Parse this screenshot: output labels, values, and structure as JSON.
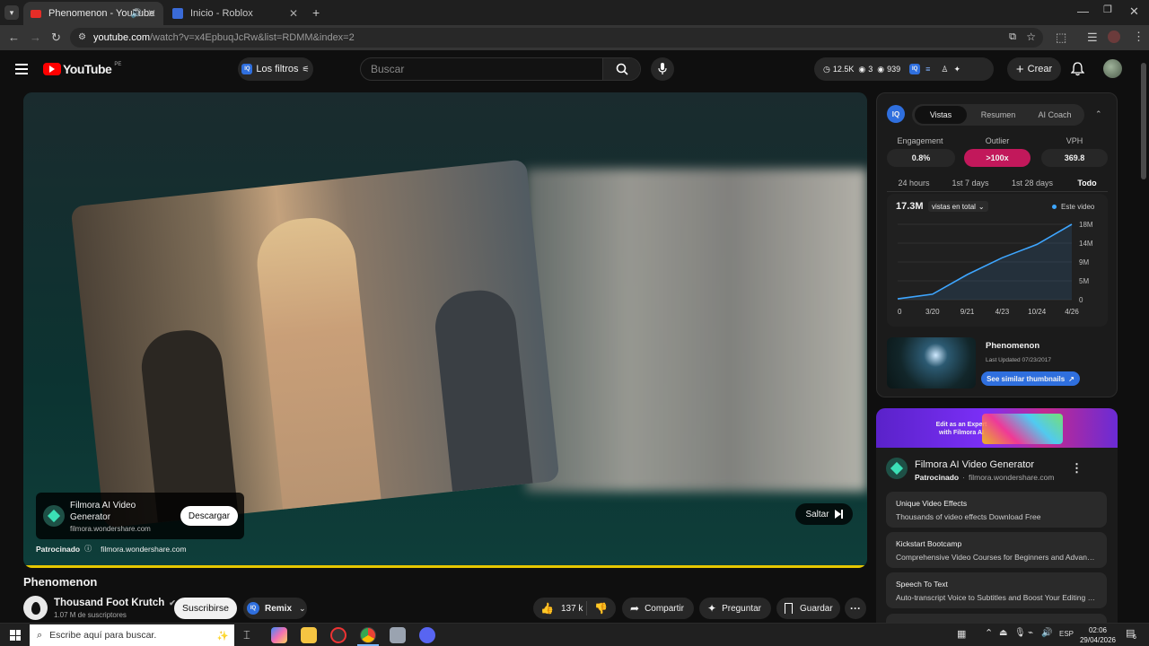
{
  "browser": {
    "tabs": [
      {
        "title": "Phenomenon - YouTube",
        "active": true
      },
      {
        "title": "Inicio - Roblox",
        "active": false
      }
    ],
    "url_host": "youtube.com",
    "url_path": "/watch?v=x4EpbuqJcRw&list=RDMM&index=2"
  },
  "masthead": {
    "logo_text": "YouTube",
    "country_code": "PE",
    "filters_label": "Los filtros",
    "search_placeholder": "Buscar",
    "stats": {
      "views": "12.5K",
      "count_a": "3",
      "count_b": "939"
    },
    "create_label": "Crear"
  },
  "ad_overlay": {
    "title_line1": "Filmora AI Video",
    "title_line2": "Generator",
    "domain": "filmora.wondershare.com",
    "download_label": "Descargar",
    "sponsored_label": "Patrocinado",
    "footer_domain": "filmora.wondershare.com",
    "skip_label": "Saltar"
  },
  "video": {
    "title": "Phenomenon",
    "channel": "Thousand Foot Krutch",
    "subscribers": "1.07 M de suscriptores",
    "subscribe_label": "Suscribirse",
    "remix_label": "Remix",
    "likes": "137 k",
    "share_label": "Compartir",
    "ask_label": "Preguntar",
    "save_label": "Guardar"
  },
  "analytics": {
    "tabs": [
      "Vistas",
      "Resumen",
      "AI Coach"
    ],
    "active_tab": "Vistas",
    "metrics": [
      {
        "label": "Engagement",
        "value": "0.8%"
      },
      {
        "label": "Outlier",
        "value": ">100x"
      },
      {
        "label": "VPH",
        "value": "369.8"
      }
    ],
    "ranges": [
      "24 hours",
      "1st 7 days",
      "1st 28 days",
      "Todo"
    ],
    "active_range": "Todo",
    "total_views": "17.3M",
    "views_dropdown": "vistas en total",
    "legend_label": "Este video",
    "related_title": "Phenomenon",
    "related_updated": "Last Updated 07/23/2017",
    "similar_button": "See similar thumbnails",
    "accent_color": "#3ea6ff",
    "outlier_color": "#c2185b"
  },
  "chart_data": {
    "type": "area",
    "x": [
      "0",
      "3/20",
      "9/21",
      "4/23",
      "10/24",
      "4/26"
    ],
    "ytick_labels": [
      "18M",
      "14M",
      "9M",
      "5M",
      "0"
    ],
    "ylim": [
      0,
      18
    ],
    "series": [
      {
        "name": "Este video",
        "values": [
          0.2,
          1.3,
          6.0,
          10.0,
          13.2,
          18.0
        ]
      }
    ]
  },
  "sponsor": {
    "banner_line1": "Edit as an Expert",
    "banner_line2": "with Filmora AI",
    "title": "Filmora AI Video Generator",
    "sponsored": "Patrocinado",
    "domain": "filmora.wondershare.com",
    "tiles": [
      {
        "title": "Unique Video Effects",
        "desc": "Thousands of video effects Download Free"
      },
      {
        "title": "Kickstart Bootcamp",
        "desc": "Comprehensive Video Courses for Beginners and Advanced ..."
      },
      {
        "title": "Speech To Text",
        "desc": "Auto-transcript Voice to Subtitles and Boost Your Editing Effi..."
      }
    ]
  },
  "taskbar": {
    "search_placeholder": "Escribe aquí para buscar.",
    "language": "ESP",
    "time": "02:06",
    "date": "29/04/2026",
    "notification_count": "6"
  }
}
